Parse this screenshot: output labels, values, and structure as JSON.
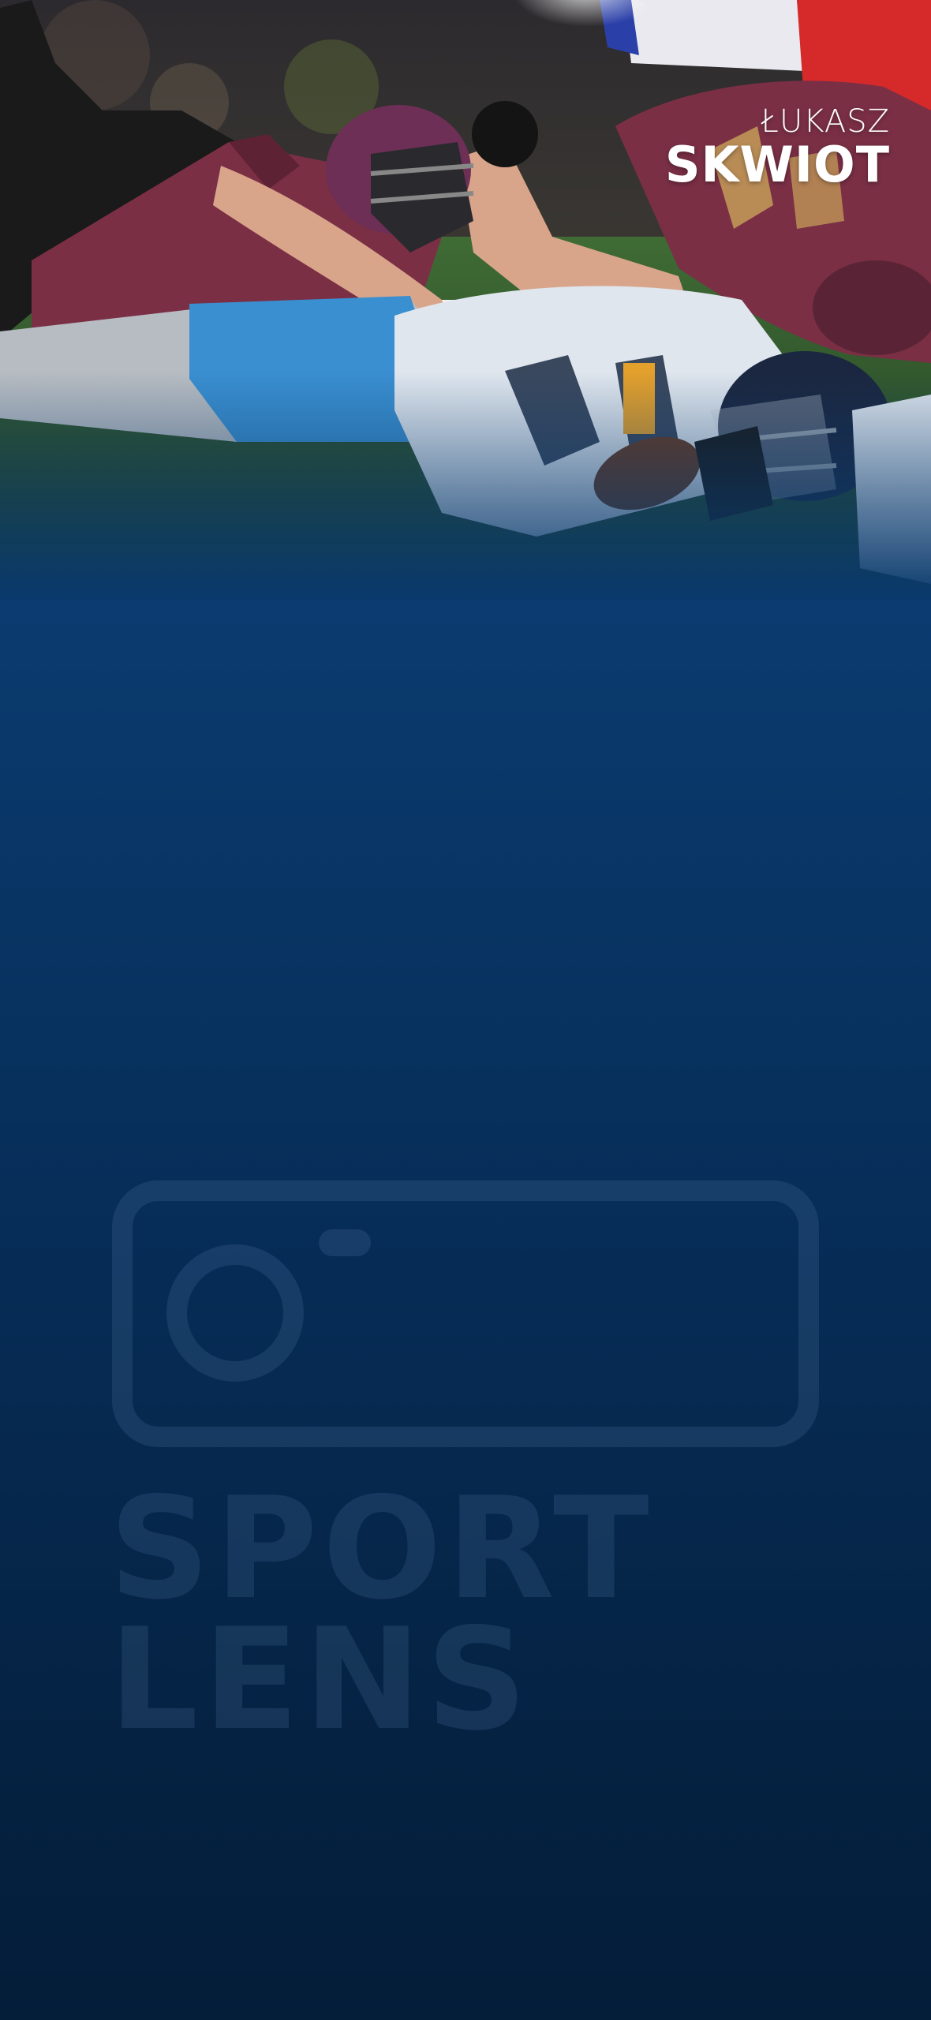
{
  "credit": {
    "first_name": "ŁUKASZ",
    "last_name": "SKWIOT"
  },
  "watermark": {
    "icon": "camera-icon",
    "line1": "SPORT",
    "line2": "LENS"
  },
  "colors": {
    "background_top": "#0a3a6d",
    "background_bottom": "#041d39",
    "watermark": "#6e96be",
    "home_jersey": "#7a2f45",
    "away_jersey": "#dfe6ee",
    "away_pants": "#3a8fd0"
  },
  "hero": {
    "subject": "american-football-tackle-photo"
  }
}
